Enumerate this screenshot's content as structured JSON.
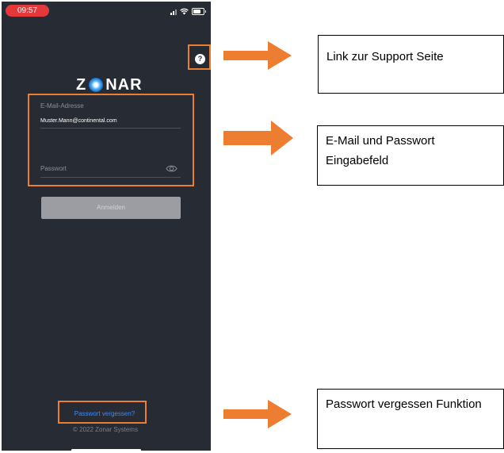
{
  "status_bar": {
    "time": "09:57"
  },
  "app": {
    "help_symbol": "?",
    "logo": {
      "left": "Z",
      "right": "NAR"
    },
    "email": {
      "label": "E-Mail-Adresse",
      "value": "Muster.Mann@continental.com"
    },
    "password": {
      "label": "Passwort"
    },
    "login_button": "Anmelden",
    "forgot_link": "Passwort vergessen?",
    "copyright": "© 2022 Zonar Systems"
  },
  "annotations": {
    "support": "Link zur Support Seite",
    "credentials": "E-Mail und Passwort Eingabefeld",
    "forgot": "Passwort vergessen Funktion"
  },
  "colors": {
    "highlight": "#ed7d31",
    "app_background": "#272b33",
    "link": "#3d8bff",
    "status_pill": "#e5383b"
  }
}
